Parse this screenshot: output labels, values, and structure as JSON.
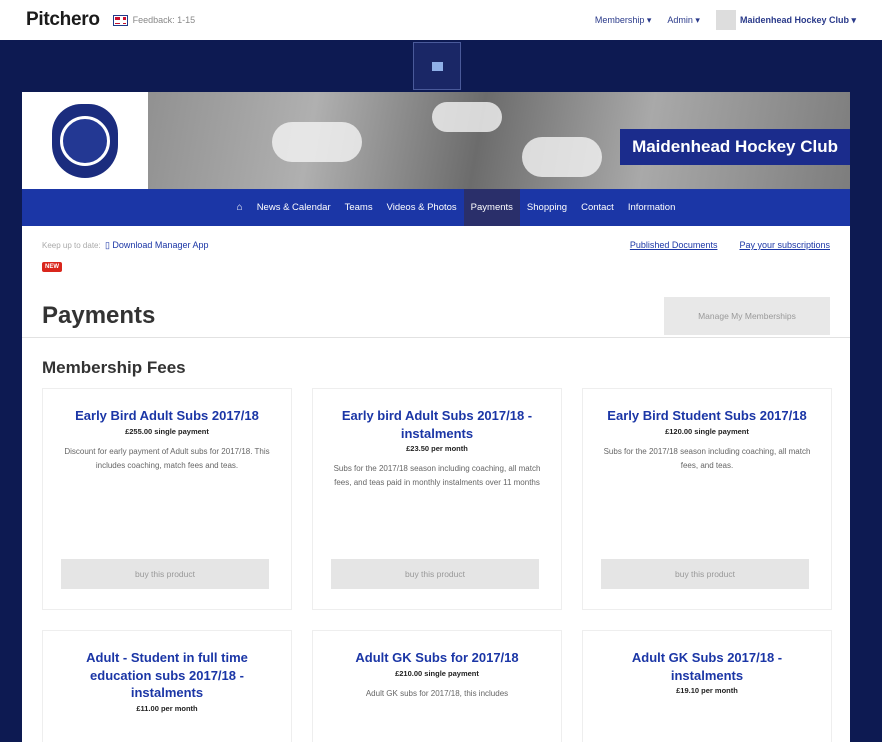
{
  "topbar": {
    "brand": "Pitchero",
    "feedback": "Feedback: 1-15",
    "links": [
      "Membership ▾",
      "Admin ▾"
    ],
    "user": "Maidenhead Hockey Club ▾"
  },
  "banner": {
    "club_name": "Maidenhead Hockey Club"
  },
  "nav": {
    "items": [
      "News & Calendar",
      "Teams",
      "Videos & Photos",
      "Payments",
      "Shopping",
      "Contact",
      "Information"
    ],
    "active": "Payments"
  },
  "subbar": {
    "prefix": "Keep up to date:",
    "app_link": "Download Manager App",
    "new_badge": "NEW",
    "right_links": [
      "Published Documents",
      "Pay your subscriptions"
    ]
  },
  "page": {
    "title": "Payments",
    "manage_button": "Manage My Memberships",
    "section_title": "Membership Fees"
  },
  "products": [
    {
      "title": "Early Bird Adult Subs 2017/18",
      "price": "£255.00 single payment",
      "desc": "Discount for early payment of Adult subs for 2017/18. This includes coaching, match fees and teas.",
      "button": "buy this product"
    },
    {
      "title": "Early bird Adult Subs 2017/18 - instalments",
      "price": "£23.50 per month",
      "desc": "Subs for the 2017/18 season including coaching, all match fees, and teas paid in monthly instalments over 11 months",
      "button": "buy this product"
    },
    {
      "title": "Early Bird Student Subs 2017/18",
      "price": "£120.00 single payment",
      "desc": "Subs for the 2017/18 season including coaching, all match fees, and teas.",
      "button": "buy this product"
    },
    {
      "title": "Adult - Student in full time education subs 2017/18 - instalments",
      "price": "£11.00 per month",
      "desc": "",
      "button": ""
    },
    {
      "title": "Adult GK Subs for 2017/18",
      "price": "£210.00 single payment",
      "desc": "Adult GK subs for 2017/18, this includes",
      "button": ""
    },
    {
      "title": "Adult GK Subs 2017/18 - instalments",
      "price": "£19.10 per month",
      "desc": "",
      "button": ""
    }
  ]
}
